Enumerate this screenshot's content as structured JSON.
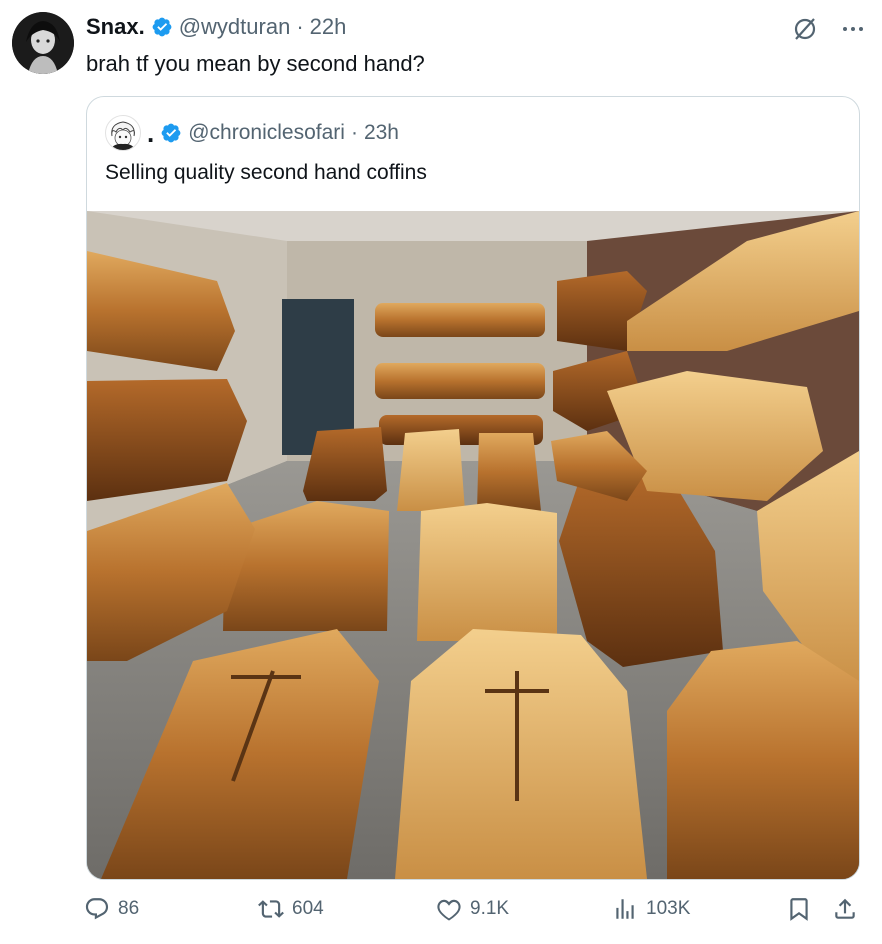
{
  "post": {
    "author_name": "Snax.",
    "author_handle": "@wydturan",
    "separator": "·",
    "time": "22h",
    "text": "brah tf you mean by second hand?"
  },
  "quoted": {
    "author_name": ".",
    "author_handle": "@chroniclesofari",
    "separator": "·",
    "time": "23h",
    "text": "Selling quality second hand coffins"
  },
  "stats": {
    "replies": "86",
    "reposts": "604",
    "likes": "9.1K",
    "views": "103K"
  },
  "icons": {
    "verified": "verified-badge-icon",
    "grok": "grok-icon",
    "more": "more-icon",
    "reply": "reply-icon",
    "repost": "repost-icon",
    "like": "heart-icon",
    "views": "views-icon",
    "bookmark": "bookmark-icon",
    "share": "share-icon"
  },
  "colors": {
    "verified": "#1d9bf0",
    "muted": "#536471",
    "text": "#0f1419",
    "border": "#cfd9de"
  }
}
